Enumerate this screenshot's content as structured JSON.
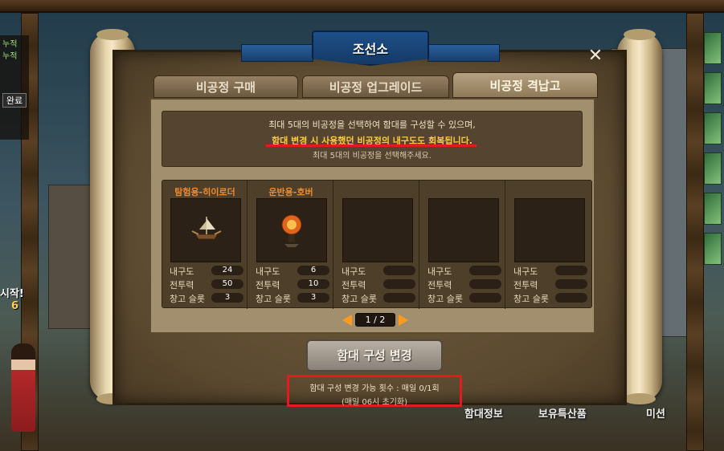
{
  "window": {
    "title": "조선소",
    "close_label": "✕"
  },
  "tabs": [
    {
      "label": "비공정 구매",
      "active": false
    },
    {
      "label": "비공정 업그레이드",
      "active": false
    },
    {
      "label": "비공정 격납고",
      "active": true
    }
  ],
  "notice": {
    "line1": "최대 5대의 비공정을 선택하여 함대를 구성할 수 있으며,",
    "line2": "함대 변경 시 사용했던 비공정의 내구도도 회복됩니다.",
    "line3": "최대 5대의 비공정을 선택해주세요."
  },
  "stat_labels": {
    "durability": "내구도",
    "power": "전투력",
    "storage": "창고 슬롯"
  },
  "slots": [
    {
      "name": "탐험용-히이로더",
      "icon": "airship-explorer-icon",
      "durability": "24",
      "power": "50",
      "storage": "3"
    },
    {
      "name": "운반용-호버",
      "icon": "airship-hover-icon",
      "durability": "6",
      "power": "10",
      "storage": "3"
    },
    {
      "name": "",
      "icon": "",
      "durability": "",
      "power": "",
      "storage": ""
    },
    {
      "name": "",
      "icon": "",
      "durability": "",
      "power": "",
      "storage": ""
    },
    {
      "name": "",
      "icon": "",
      "durability": "",
      "power": "",
      "storage": ""
    }
  ],
  "pager": {
    "text": "1 / 2"
  },
  "change_button": {
    "label": "함대 구성 변경"
  },
  "change_count": {
    "line1": "함대 구성 변경 가능 횟수 : 매일 0/1회",
    "line2": "(매일 06시 초기화)"
  },
  "background": {
    "left_quest_line1": "누적",
    "left_quest_line2": "누적",
    "left_quest_done": "완료",
    "start_text": "시작!",
    "start_num": "6",
    "bottom_menu": [
      "함대정보",
      "보유특산품",
      "미션"
    ]
  },
  "colors": {
    "accent_orange": "#f08a2a",
    "highlight_yellow": "#ffcc33",
    "annotation_red": "#e5191e",
    "title_blue": "#1e4f88"
  }
}
